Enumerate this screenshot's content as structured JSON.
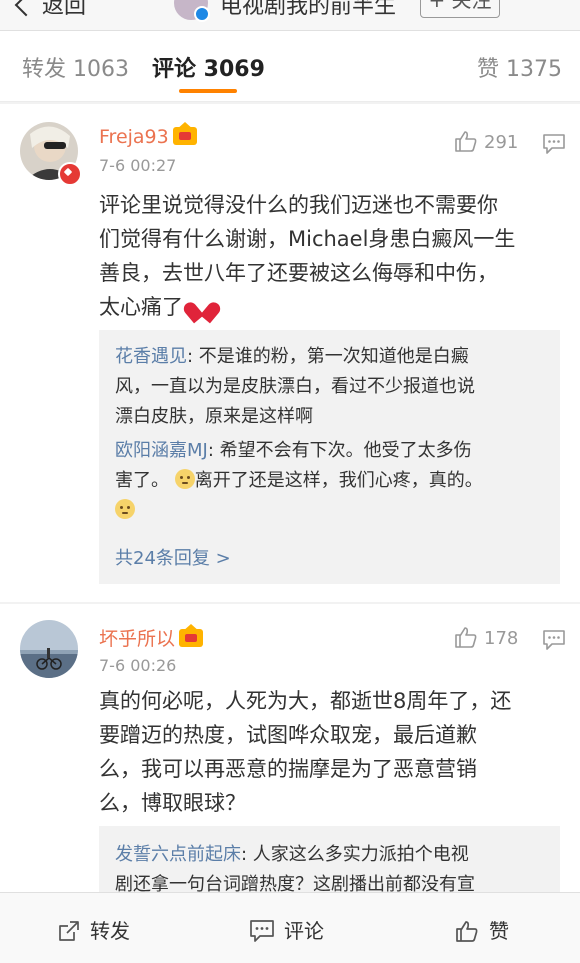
{
  "topnav": {
    "back_label": "返回",
    "account_name": "电视剧我的前半生",
    "follow_label": "+ 关注"
  },
  "tabs": {
    "repost": "转发 1063",
    "comments": "评论 3069",
    "likes": "赞 1375"
  },
  "comments": [
    {
      "username": "Freja93",
      "time": "7-6 00:27",
      "likes": "291",
      "text_lines": [
        "评论里说觉得没什么的我们迈迷也不需要你",
        "们觉得有什么谢谢，Michael身患白癜风一生",
        "善良，去世八年了还要被这么侮辱和中伤，",
        "太心痛了"
      ],
      "replies": [
        {
          "name": "花香遇见",
          "lines": [
            ": 不是谁的粉，第一次知道他是白癜",
            "风，一直以为是皮肤漂白，看过不少报道也说",
            "漂白皮肤，原来是这样啊"
          ]
        },
        {
          "name": "欧阳涵嘉MJ",
          "lines": [
            ": 希望不会有下次。他受了太多伤",
            "害了。",
            "离开了还是这样，我们心疼，真的。"
          ]
        }
      ],
      "more_replies": "共24条回复 >"
    },
    {
      "username": "坏乎所以",
      "time": "7-6 00:26",
      "likes": "178",
      "text_lines": [
        "真的何必呢，人死为大，都逝世8周年了，还",
        "要蹭迈的热度，试图哗众取宠，最后道歉",
        "么，我可以再恶意的揣摩是为了恶意营销",
        "么，博取眼球？"
      ],
      "replies": [
        {
          "name": "发誓六点前起床",
          "lines": [
            ": 人家这么多实力派拍个电视",
            "剧还拿一句台词蹭热度？这剧播出前都没有宣"
          ]
        }
      ]
    }
  ],
  "toolbar": {
    "repost": "转发",
    "comment": "评论",
    "like": "赞"
  },
  "colors": {
    "accent": "#ff8200",
    "username": "#eb7350",
    "link": "#5b7ea8"
  }
}
